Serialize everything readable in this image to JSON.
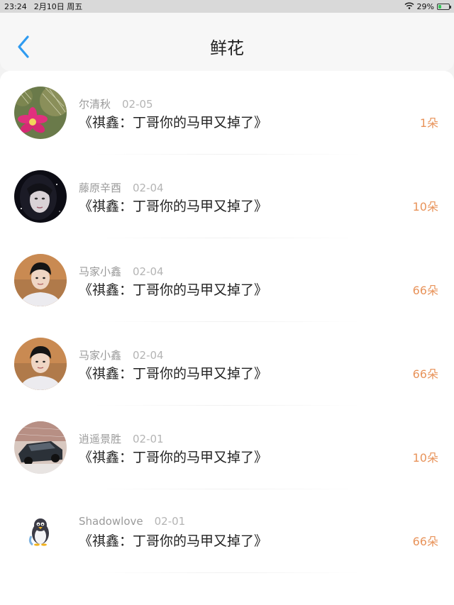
{
  "status_bar": {
    "time": "23:24",
    "date": "2月10日 周五",
    "battery": "29%",
    "battery_level": 0.29
  },
  "header": {
    "title": "鲜花"
  },
  "rows": [
    {
      "user": "尔清秋",
      "date": "02-05",
      "work": "《祺鑫：丁哥你的马甲又掉了》",
      "count": "1朵",
      "avatar": "cactus-flower-photo"
    },
    {
      "user": "藤原辛酉",
      "date": "02-04",
      "work": "《祺鑫：丁哥你的马甲又掉了》",
      "count": "10朵",
      "avatar": "girl-portrait-photo"
    },
    {
      "user": "马家小鑫",
      "date": "02-04",
      "work": "《祺鑫：丁哥你的马甲又掉了》",
      "count": "66朵",
      "avatar": "boy-portrait-photo"
    },
    {
      "user": "马家小鑫",
      "date": "02-04",
      "work": "《祺鑫：丁哥你的马甲又掉了》",
      "count": "66朵",
      "avatar": "boy-portrait-photo"
    },
    {
      "user": "逍遥景胜",
      "date": "02-01",
      "work": "《祺鑫：丁哥你的马甲又掉了》",
      "count": "10朵",
      "avatar": "car-photo"
    },
    {
      "user": "Shadowlove",
      "date": "02-01",
      "work": "《祺鑫：丁哥你的马甲又掉了》",
      "count": "66朵",
      "avatar": "penguin-icon"
    }
  ],
  "colors": {
    "accent_blue": "#2f9bf0",
    "count_orange": "#e8935a"
  }
}
